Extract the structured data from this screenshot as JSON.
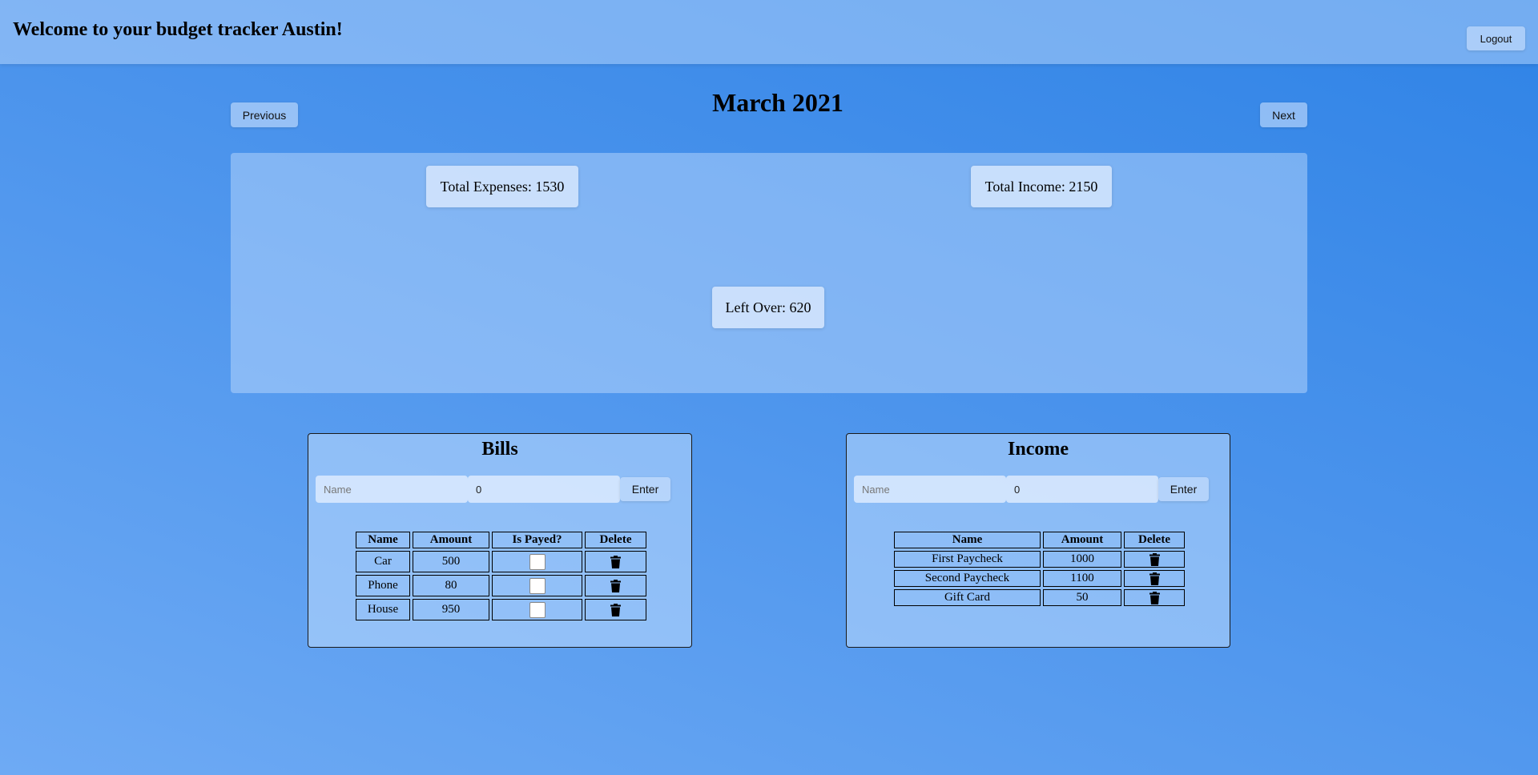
{
  "header": {
    "welcome": "Welcome to your budget tracker Austin!",
    "logout_label": "Logout"
  },
  "nav": {
    "previous_label": "Previous",
    "next_label": "Next",
    "month_title": "March 2021"
  },
  "summary": {
    "total_expenses": "Total Expenses: 1530",
    "total_income": "Total Income: 2150",
    "left_over": "Left Over: 620"
  },
  "bills": {
    "title": "Bills",
    "name_placeholder": "Name",
    "amount_value": "0",
    "enter_label": "Enter",
    "columns": [
      "Name",
      "Amount",
      "Is Payed?",
      "Delete"
    ],
    "rows": [
      {
        "name": "Car",
        "amount": "500",
        "payed": false
      },
      {
        "name": "Phone",
        "amount": "80",
        "payed": false
      },
      {
        "name": "House",
        "amount": "950",
        "payed": false
      }
    ]
  },
  "income": {
    "title": "Income",
    "name_placeholder": "Name",
    "amount_value": "0",
    "enter_label": "Enter",
    "columns": [
      "Name",
      "Amount",
      "Delete"
    ],
    "rows": [
      {
        "name": "First Paycheck",
        "amount": "1000"
      },
      {
        "name": "Second Paycheck",
        "amount": "1100"
      },
      {
        "name": "Gift Card",
        "amount": "50"
      }
    ]
  },
  "icons": {
    "delete": "trash-icon"
  }
}
